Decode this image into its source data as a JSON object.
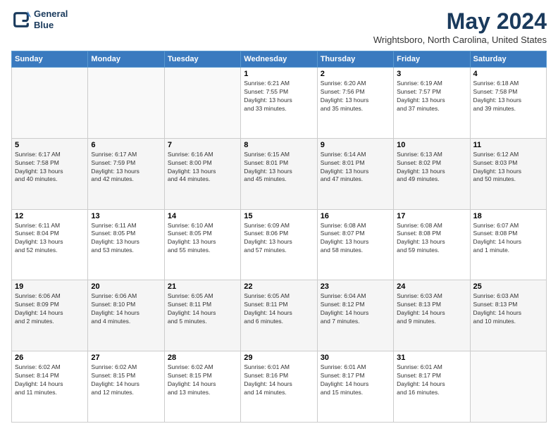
{
  "header": {
    "logo_line1": "General",
    "logo_line2": "Blue",
    "title": "May 2024",
    "location": "Wrightsboro, North Carolina, United States"
  },
  "days_of_week": [
    "Sunday",
    "Monday",
    "Tuesday",
    "Wednesday",
    "Thursday",
    "Friday",
    "Saturday"
  ],
  "weeks": [
    [
      {
        "day": "",
        "info": ""
      },
      {
        "day": "",
        "info": ""
      },
      {
        "day": "",
        "info": ""
      },
      {
        "day": "1",
        "info": "Sunrise: 6:21 AM\nSunset: 7:55 PM\nDaylight: 13 hours\nand 33 minutes."
      },
      {
        "day": "2",
        "info": "Sunrise: 6:20 AM\nSunset: 7:56 PM\nDaylight: 13 hours\nand 35 minutes."
      },
      {
        "day": "3",
        "info": "Sunrise: 6:19 AM\nSunset: 7:57 PM\nDaylight: 13 hours\nand 37 minutes."
      },
      {
        "day": "4",
        "info": "Sunrise: 6:18 AM\nSunset: 7:58 PM\nDaylight: 13 hours\nand 39 minutes."
      }
    ],
    [
      {
        "day": "5",
        "info": "Sunrise: 6:17 AM\nSunset: 7:58 PM\nDaylight: 13 hours\nand 40 minutes."
      },
      {
        "day": "6",
        "info": "Sunrise: 6:17 AM\nSunset: 7:59 PM\nDaylight: 13 hours\nand 42 minutes."
      },
      {
        "day": "7",
        "info": "Sunrise: 6:16 AM\nSunset: 8:00 PM\nDaylight: 13 hours\nand 44 minutes."
      },
      {
        "day": "8",
        "info": "Sunrise: 6:15 AM\nSunset: 8:01 PM\nDaylight: 13 hours\nand 45 minutes."
      },
      {
        "day": "9",
        "info": "Sunrise: 6:14 AM\nSunset: 8:01 PM\nDaylight: 13 hours\nand 47 minutes."
      },
      {
        "day": "10",
        "info": "Sunrise: 6:13 AM\nSunset: 8:02 PM\nDaylight: 13 hours\nand 49 minutes."
      },
      {
        "day": "11",
        "info": "Sunrise: 6:12 AM\nSunset: 8:03 PM\nDaylight: 13 hours\nand 50 minutes."
      }
    ],
    [
      {
        "day": "12",
        "info": "Sunrise: 6:11 AM\nSunset: 8:04 PM\nDaylight: 13 hours\nand 52 minutes."
      },
      {
        "day": "13",
        "info": "Sunrise: 6:11 AM\nSunset: 8:05 PM\nDaylight: 13 hours\nand 53 minutes."
      },
      {
        "day": "14",
        "info": "Sunrise: 6:10 AM\nSunset: 8:05 PM\nDaylight: 13 hours\nand 55 minutes."
      },
      {
        "day": "15",
        "info": "Sunrise: 6:09 AM\nSunset: 8:06 PM\nDaylight: 13 hours\nand 57 minutes."
      },
      {
        "day": "16",
        "info": "Sunrise: 6:08 AM\nSunset: 8:07 PM\nDaylight: 13 hours\nand 58 minutes."
      },
      {
        "day": "17",
        "info": "Sunrise: 6:08 AM\nSunset: 8:08 PM\nDaylight: 13 hours\nand 59 minutes."
      },
      {
        "day": "18",
        "info": "Sunrise: 6:07 AM\nSunset: 8:08 PM\nDaylight: 14 hours\nand 1 minute."
      }
    ],
    [
      {
        "day": "19",
        "info": "Sunrise: 6:06 AM\nSunset: 8:09 PM\nDaylight: 14 hours\nand 2 minutes."
      },
      {
        "day": "20",
        "info": "Sunrise: 6:06 AM\nSunset: 8:10 PM\nDaylight: 14 hours\nand 4 minutes."
      },
      {
        "day": "21",
        "info": "Sunrise: 6:05 AM\nSunset: 8:11 PM\nDaylight: 14 hours\nand 5 minutes."
      },
      {
        "day": "22",
        "info": "Sunrise: 6:05 AM\nSunset: 8:11 PM\nDaylight: 14 hours\nand 6 minutes."
      },
      {
        "day": "23",
        "info": "Sunrise: 6:04 AM\nSunset: 8:12 PM\nDaylight: 14 hours\nand 7 minutes."
      },
      {
        "day": "24",
        "info": "Sunrise: 6:03 AM\nSunset: 8:13 PM\nDaylight: 14 hours\nand 9 minutes."
      },
      {
        "day": "25",
        "info": "Sunrise: 6:03 AM\nSunset: 8:13 PM\nDaylight: 14 hours\nand 10 minutes."
      }
    ],
    [
      {
        "day": "26",
        "info": "Sunrise: 6:02 AM\nSunset: 8:14 PM\nDaylight: 14 hours\nand 11 minutes."
      },
      {
        "day": "27",
        "info": "Sunrise: 6:02 AM\nSunset: 8:15 PM\nDaylight: 14 hours\nand 12 minutes."
      },
      {
        "day": "28",
        "info": "Sunrise: 6:02 AM\nSunset: 8:15 PM\nDaylight: 14 hours\nand 13 minutes."
      },
      {
        "day": "29",
        "info": "Sunrise: 6:01 AM\nSunset: 8:16 PM\nDaylight: 14 hours\nand 14 minutes."
      },
      {
        "day": "30",
        "info": "Sunrise: 6:01 AM\nSunset: 8:17 PM\nDaylight: 14 hours\nand 15 minutes."
      },
      {
        "day": "31",
        "info": "Sunrise: 6:01 AM\nSunset: 8:17 PM\nDaylight: 14 hours\nand 16 minutes."
      },
      {
        "day": "",
        "info": ""
      }
    ]
  ]
}
